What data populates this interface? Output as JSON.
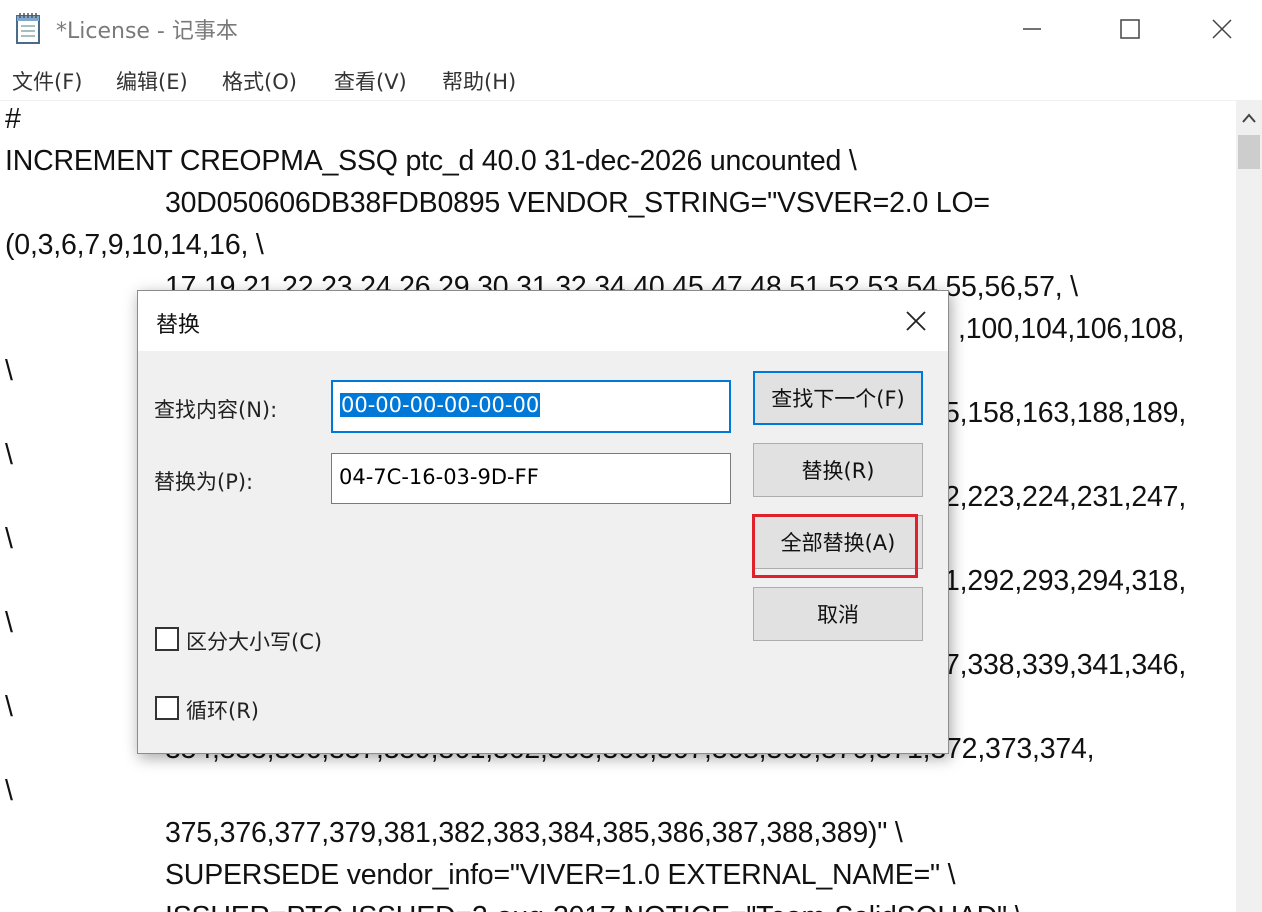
{
  "window": {
    "title": "*License - 记事本",
    "icon": "notepad-icon"
  },
  "menu": [
    {
      "label": "文件(F)"
    },
    {
      "label": "编辑(E)"
    },
    {
      "label": "格式(O)"
    },
    {
      "label": "查看(V)"
    },
    {
      "label": "帮助(H)"
    }
  ],
  "editor": {
    "lines": [
      "#",
      "INCREMENT CREOPMA_SSQ ptc_d 40.0 31-dec-2026 uncounted \\",
      "30D050606DB38FDB0895 VENDOR_STRING=\"VSVER=2.0 LO=",
      "(0,3,6,7,9,10,14,16, \\",
      "17,19,21,22,23,24,26,29,30,31,32,34,40,45,47,48,51,52,53,54,55,56,57, \\",
      ",100,104,106,108,",
      "\\",
      "5,158,163,188,189,",
      "\\",
      "2,223,224,231,247,",
      "\\",
      "1,292,293,294,318,",
      "\\",
      "7,338,339,341,346,",
      "\\",
      "354,355,356,357,359,361,362,365,366,367,368,369,370,371,372,373,374,",
      "\\",
      "375,376,377,379,381,382,383,384,385,386,387,388,389)\" \\",
      "SUPERSEDE vendor_info=\"VIVER=1.0 EXTERNAL_NAME=\" \\",
      "ISSUER=PTC ISSUED=2-aug-2017 NOTICE=\"Team-SolidSQUAD\" \\"
    ]
  },
  "dialog": {
    "title": "替换",
    "find_label": "查找内容(N):",
    "find_value": "00-00-00-00-00-00",
    "replace_label": "替换为(P):",
    "replace_value": "04-7C-16-03-9D-FF",
    "find_next_button": "查找下一个(F)",
    "replace_button": "替换(R)",
    "replace_all_button": "全部替换(A)",
    "cancel_button": "取消",
    "match_case_label": "区分大小写(C)",
    "match_case_checked": false,
    "wrap_label": "循环(R)",
    "wrap_checked": false
  },
  "colors": {
    "accent": "#0078d7",
    "highlight": "#e0202a"
  }
}
